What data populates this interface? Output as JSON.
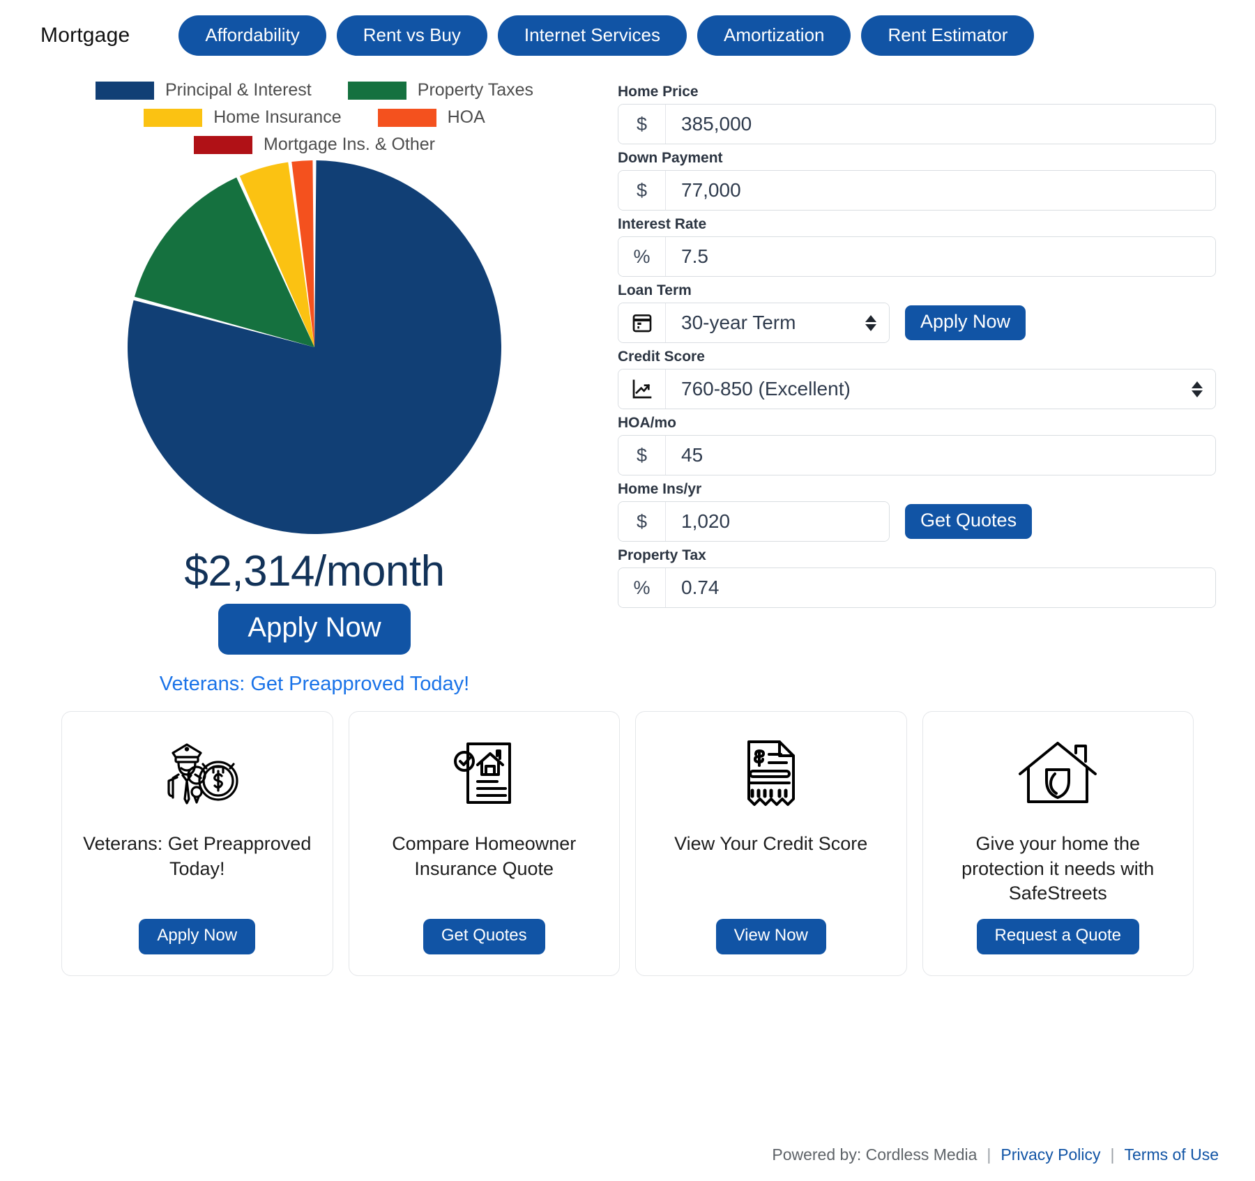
{
  "header": {
    "brand": "Mortgage",
    "tabs": [
      {
        "label": "Affordability"
      },
      {
        "label": "Rent vs Buy"
      },
      {
        "label": "Internet Services"
      },
      {
        "label": "Amortization"
      },
      {
        "label": "Rent Estimator"
      }
    ]
  },
  "chart_data": {
    "type": "pie",
    "title": "",
    "legend_position": "top",
    "categories": [
      "Principal & Interest",
      "Property Taxes",
      "Home Insurance",
      "HOA",
      "Mortgage Ins. & Other"
    ],
    "values": [
      79.2,
      14.1,
      4.6,
      2.1,
      0
    ],
    "colors": [
      "#113f75",
      "#15713f",
      "#fbc212",
      "#f4511e",
      "#b01116"
    ],
    "units": "percent of monthly payment",
    "start_angle_deg": 0,
    "direction": "clockwise",
    "legend": [
      {
        "label": "Principal & Interest",
        "color": "#113f75"
      },
      {
        "label": "Property Taxes",
        "color": "#15713f"
      },
      {
        "label": "Home Insurance",
        "color": "#fbc212"
      },
      {
        "label": "HOA",
        "color": "#f4511e"
      },
      {
        "label": "Mortgage Ins. & Other",
        "color": "#b01116"
      }
    ]
  },
  "summary": {
    "payment": "$2,314/month",
    "apply_label": "Apply Now",
    "veterans_link": "Veterans: Get Preapproved Today!"
  },
  "form": {
    "home_price": {
      "label": "Home Price",
      "addon": "$",
      "value": "385,000"
    },
    "down_payment": {
      "label": "Down Payment",
      "addon": "$",
      "value": "77,000"
    },
    "interest_rate": {
      "label": "Interest Rate",
      "addon": "%",
      "value": "7.5"
    },
    "loan_term": {
      "label": "Loan Term",
      "addon": "calendar-icon",
      "value": "30-year Term",
      "button": "Apply Now"
    },
    "credit_score": {
      "label": "Credit Score",
      "addon": "chart-line-icon",
      "value": "760-850 (Excellent)"
    },
    "hoa": {
      "label": "HOA/mo",
      "addon": "$",
      "value": "45"
    },
    "home_ins": {
      "label": "Home Ins/yr",
      "addon": "$",
      "value": "1,020",
      "button": "Get Quotes"
    },
    "property_tax": {
      "label": "Property Tax",
      "addon": "%",
      "value": "0.74"
    }
  },
  "cards": [
    {
      "icon": "veteran-officer-icon",
      "title": "Veterans: Get Preapproved Today!",
      "button": "Apply Now"
    },
    {
      "icon": "insurance-document-icon",
      "title": "Compare Homeowner Insurance Quote",
      "button": "Get Quotes"
    },
    {
      "icon": "credit-report-icon",
      "title": "View Your Credit Score",
      "button": "View Now"
    },
    {
      "icon": "home-shield-icon",
      "title": "Give your home the protection it needs with SafeStreets",
      "button": "Request a Quote"
    }
  ],
  "footer": {
    "powered_by": "Powered by: Cordless Media",
    "sep1": "|",
    "privacy": "Privacy Policy",
    "sep2": "|",
    "terms": "Terms of Use"
  }
}
